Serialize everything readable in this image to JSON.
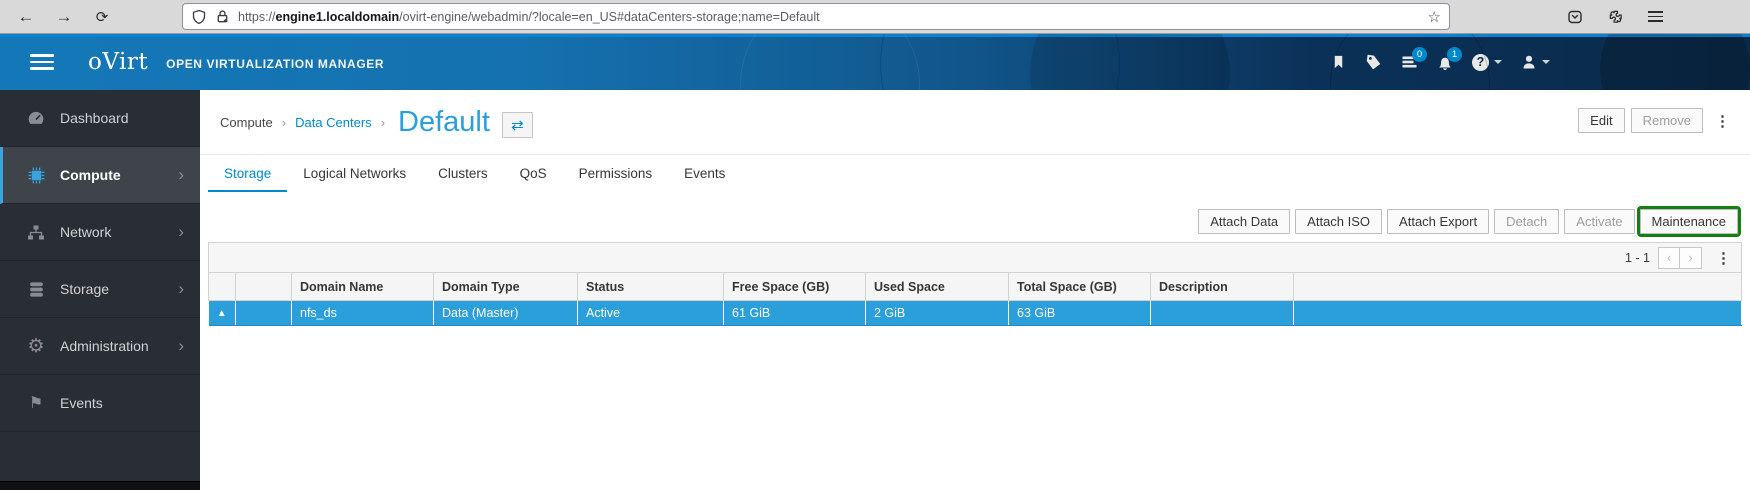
{
  "browser": {
    "url": {
      "scheme": "https://",
      "domain": "engine1.localdomain",
      "path": "/ovirt-engine/webadmin/?locale=en_US#dataCenters-storage;name=Default"
    }
  },
  "masthead": {
    "brand": "oVirt",
    "product": "OPEN VIRTUALIZATION MANAGER",
    "badges": {
      "tasks": "0",
      "alerts": "1"
    }
  },
  "sidebar": {
    "items": [
      {
        "label": "Dashboard"
      },
      {
        "label": "Compute"
      },
      {
        "label": "Network"
      },
      {
        "label": "Storage"
      },
      {
        "label": "Administration"
      },
      {
        "label": "Events"
      }
    ]
  },
  "page": {
    "breadcrumb": {
      "root": "Compute",
      "section": "Data Centers"
    },
    "title": "Default",
    "edit_label": "Edit",
    "remove_label": "Remove"
  },
  "tabs": [
    {
      "label": "Storage"
    },
    {
      "label": "Logical Networks"
    },
    {
      "label": "Clusters"
    },
    {
      "label": "QoS"
    },
    {
      "label": "Permissions"
    },
    {
      "label": "Events"
    }
  ],
  "actions": [
    {
      "label": "Attach Data"
    },
    {
      "label": "Attach ISO"
    },
    {
      "label": "Attach Export"
    },
    {
      "label": "Detach"
    },
    {
      "label": "Activate"
    },
    {
      "label": "Maintenance"
    }
  ],
  "grid": {
    "pagination": "1 - 1",
    "columns": [
      "Domain Name",
      "Domain Type",
      "Status",
      "Free Space (GB)",
      "Used Space",
      "Total Space (GB)",
      "Description"
    ],
    "row": {
      "status_icon": "up-arrow",
      "domain_name": "nfs_ds",
      "domain_type": "Data (Master)",
      "status": "Active",
      "free_space": "61 GiB",
      "used_space": "2 GiB",
      "total_space": "63 GiB",
      "description": ""
    }
  },
  "colors": {
    "accent_blue": "#0088ce",
    "masthead_left": "#1478b8",
    "masthead_right": "#0a2a49",
    "sidebar_bg": "#292e34",
    "sidebar_active_accent": "#39a5dc",
    "selected_row": "#2a9fd9",
    "status_up_green": "#2db52d",
    "highlight_border_green": "#148014"
  }
}
